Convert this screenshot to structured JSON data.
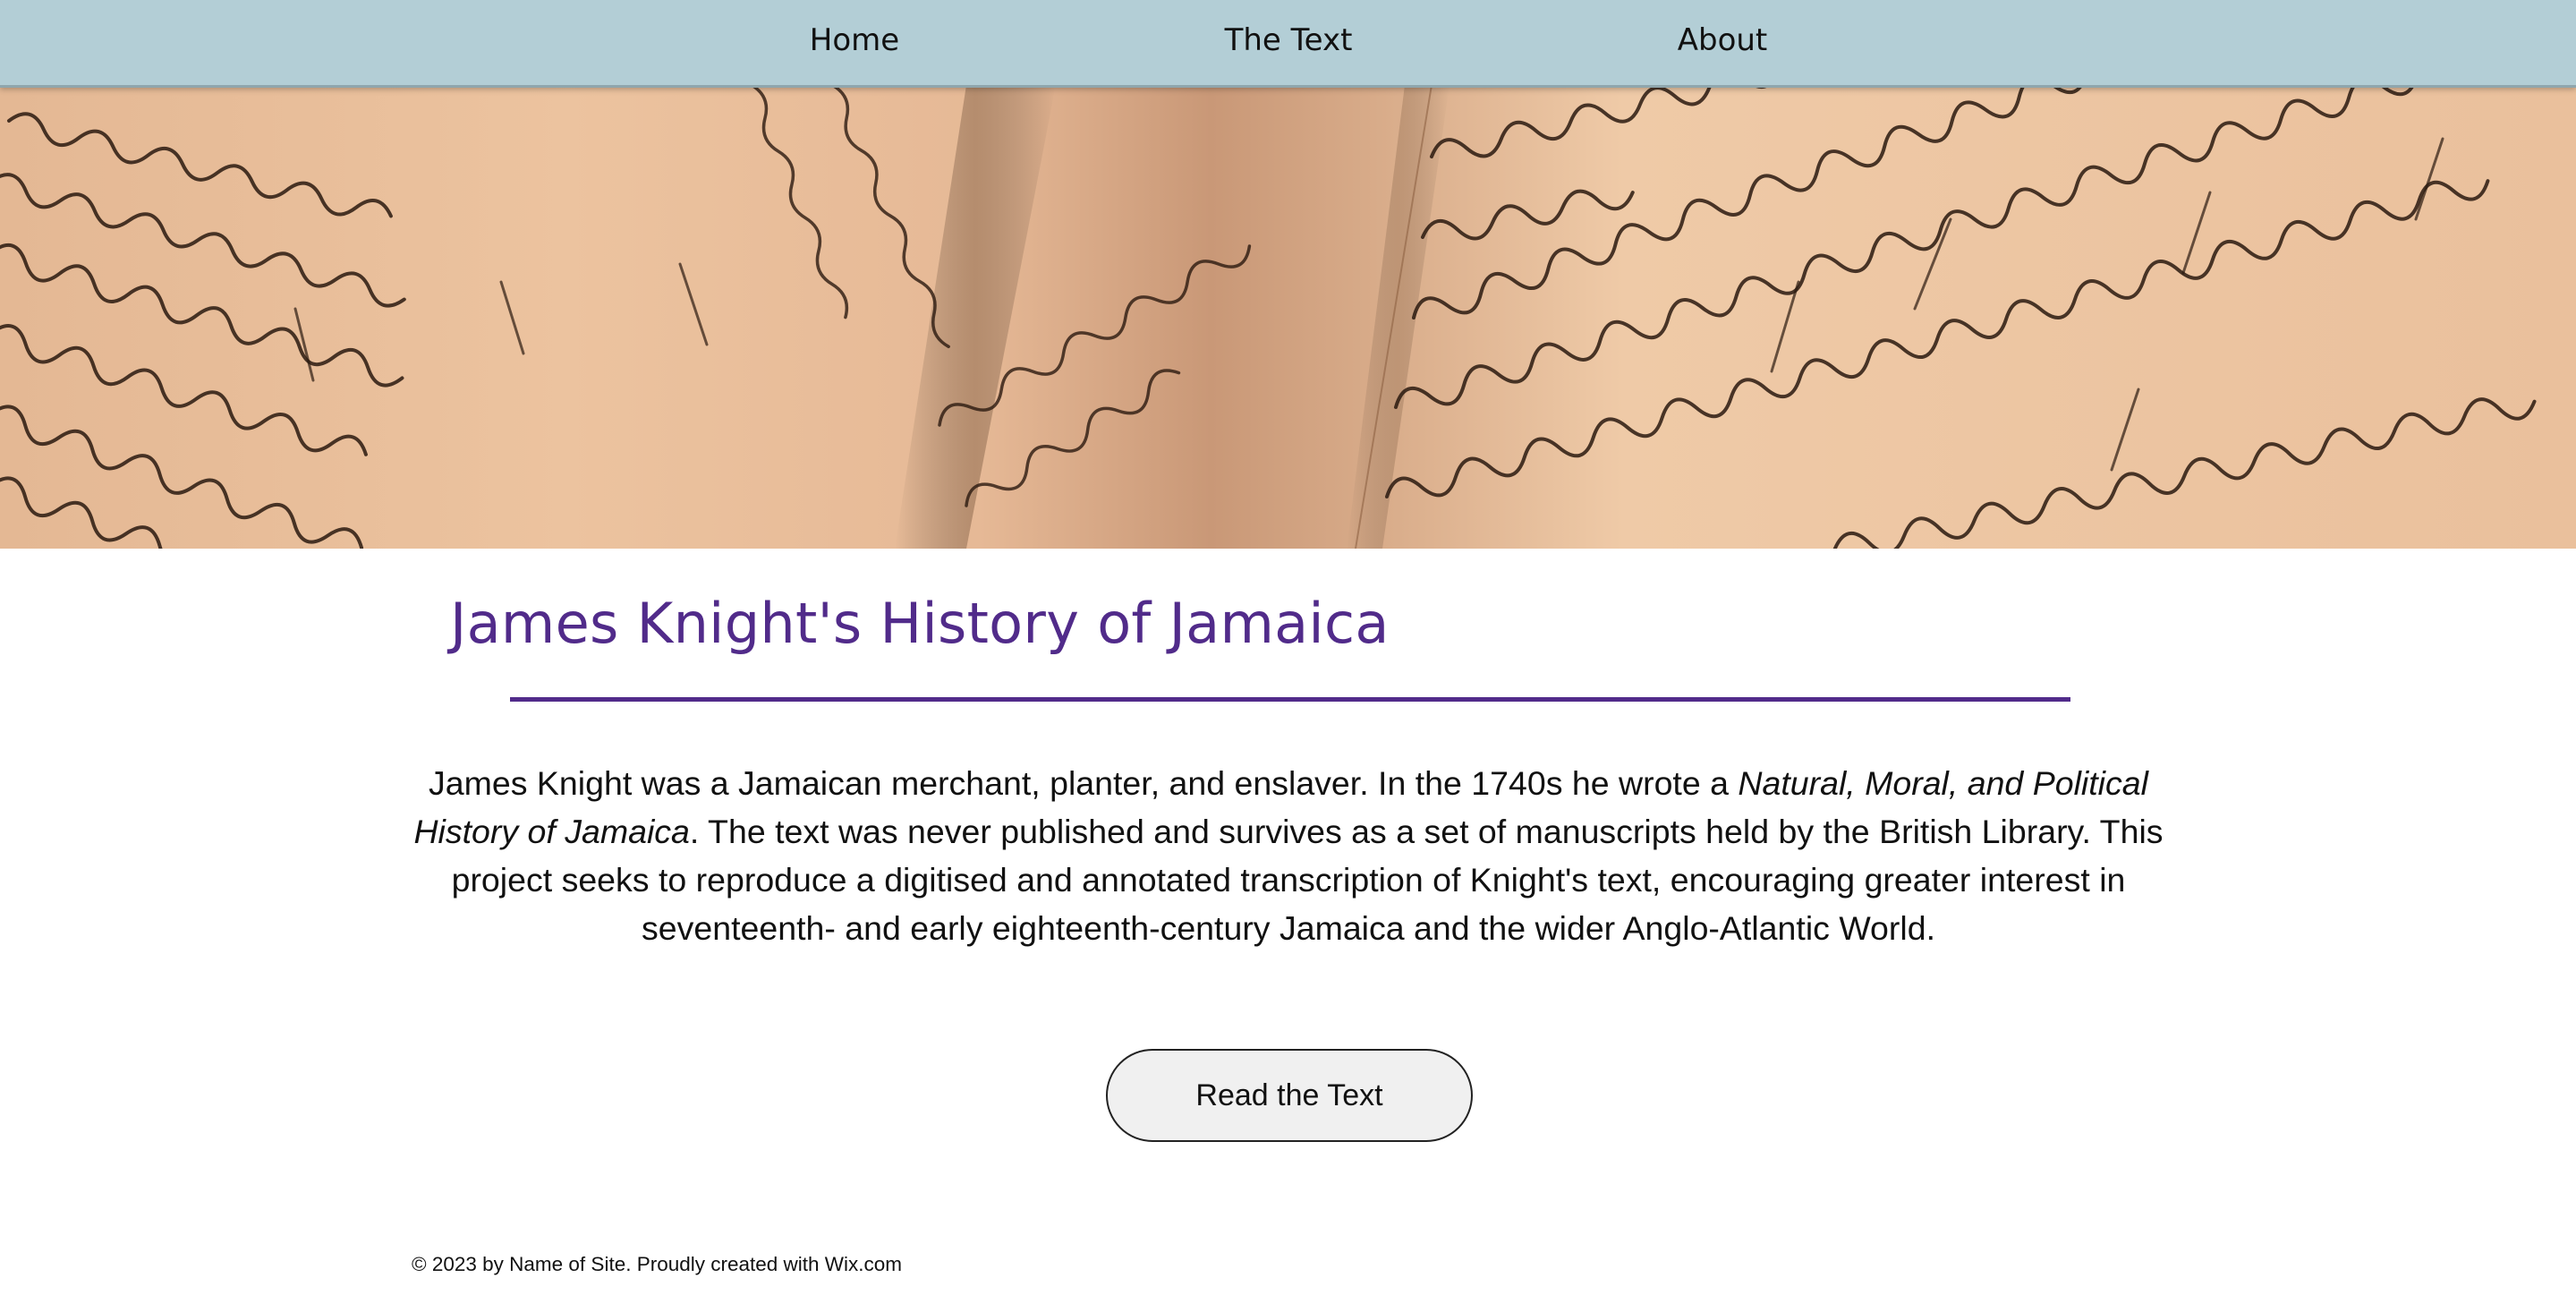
{
  "nav": {
    "items": [
      {
        "label": "Home"
      },
      {
        "label": "The Text"
      },
      {
        "label": "About"
      }
    ]
  },
  "hero": {
    "image": "handwritten-manuscript-photo"
  },
  "main": {
    "title": "James Knight's History of Jamaica",
    "intro": {
      "part1": "James Knight was a Jamaican merchant, planter, and enslaver. In the 1740s he wrote a ",
      "book_title": "Natural, Moral, and Political History of Jamaica",
      "part2": ". The text was never published and survives as a set of manuscripts held by the British Library. This project seeks to reproduce a digitised and annotated transcription of Knight's text, encouraging greater interest in seventeenth- and early eighteenth-century Jamaica and the wider Anglo-Atlantic World."
    },
    "button_label": "Read the Text"
  },
  "footer": {
    "text": "© 2023 by Name of Site. Proudly created with Wix.com"
  },
  "colors": {
    "nav_bg": "#b3ced6",
    "title": "#512b8a",
    "divider": "#512b8a",
    "button_bg": "#f0f0f0"
  }
}
